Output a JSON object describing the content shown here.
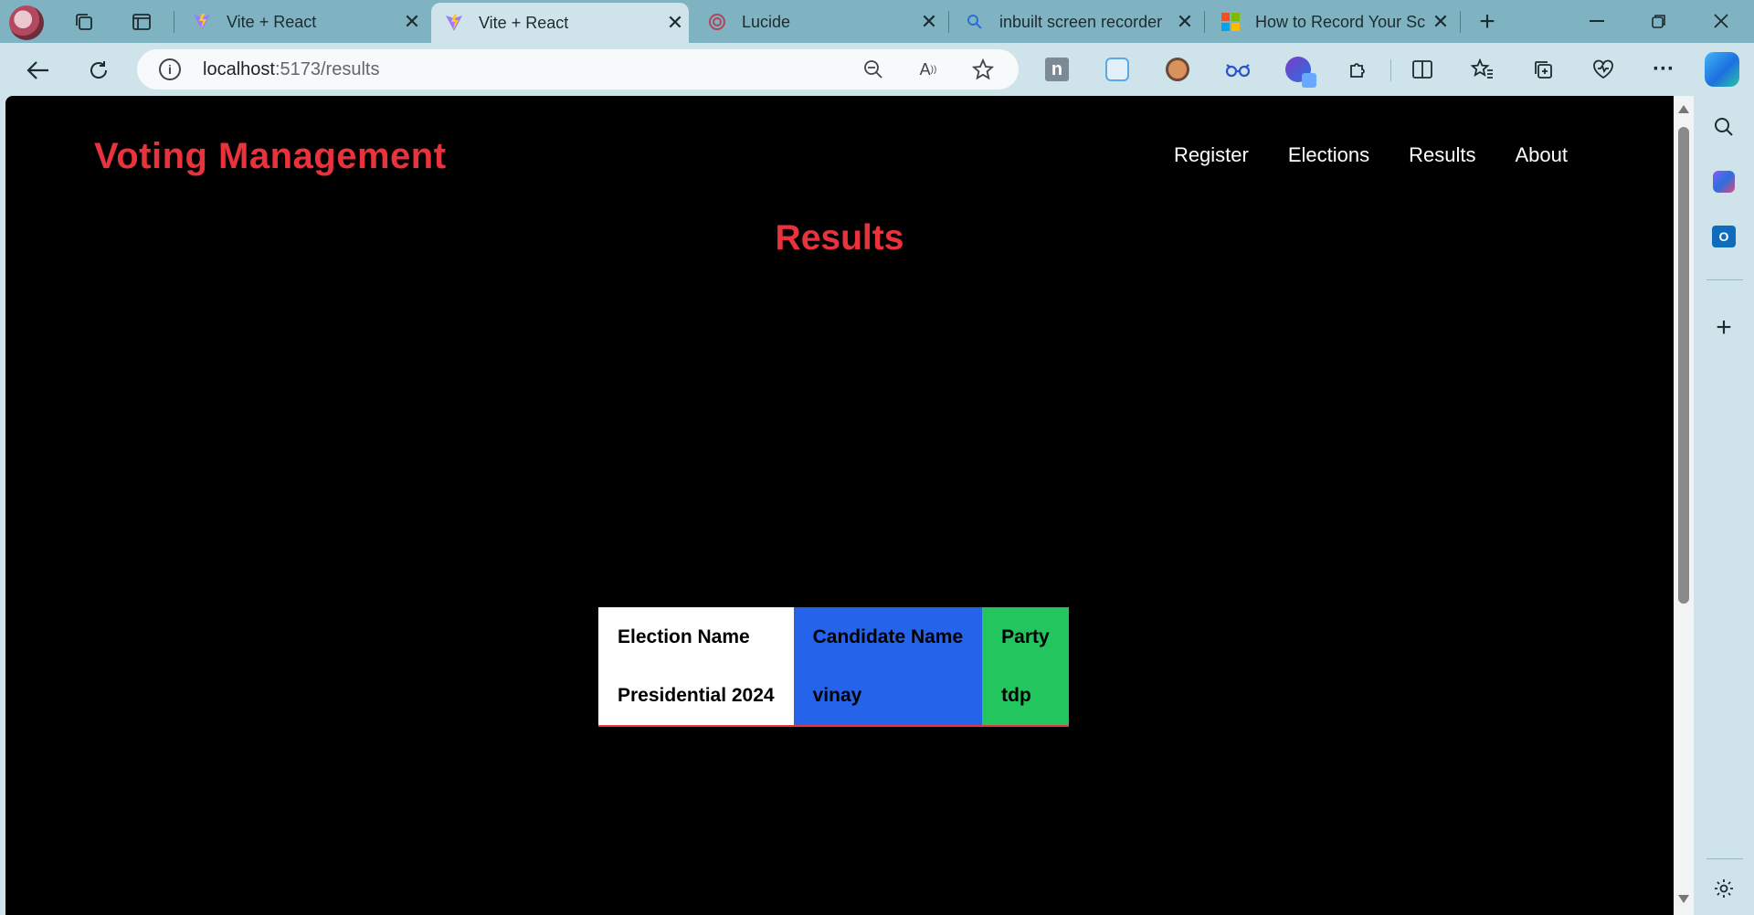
{
  "tabs": [
    {
      "title": "Vite + React",
      "active": false,
      "favicon": "vite-icon"
    },
    {
      "title": "Vite + React",
      "active": true,
      "favicon": "vite-icon"
    },
    {
      "title": "Lucide",
      "active": false,
      "favicon": "lucide-icon"
    },
    {
      "title": "inbuilt screen recorder",
      "active": false,
      "favicon": "search-icon"
    },
    {
      "title": "How to Record Your Sc",
      "active": false,
      "favicon": "microsoft-icon"
    }
  ],
  "address": {
    "host": "localhost",
    "path": ":5173/results"
  },
  "site": {
    "brand": "Voting Management",
    "nav": [
      "Register",
      "Elections",
      "Results",
      "About"
    ],
    "page_title": "Results"
  },
  "table": {
    "headers": [
      "Election Name",
      "Candidate Name",
      "Party"
    ],
    "rows": [
      [
        "Presidential 2024",
        "vinay",
        "tdp"
      ]
    ]
  },
  "colors": {
    "accent_red": "#e8323c",
    "col_blue": "#2563eb",
    "col_green": "#22c55e",
    "page_bg": "#000000",
    "chrome_bg": "#cfe3ea"
  }
}
